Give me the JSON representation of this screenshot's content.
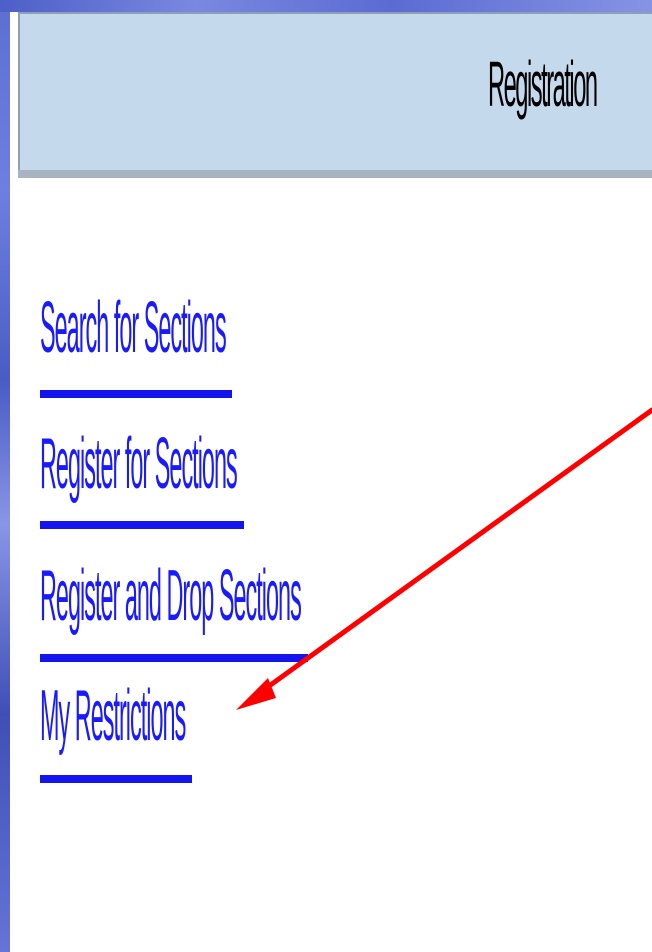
{
  "header": {
    "title": "Registration"
  },
  "links": [
    {
      "label": "Search for Sections"
    },
    {
      "label": "Register for Sections"
    },
    {
      "label": "Register and Drop Sections"
    },
    {
      "label": "My Restrictions"
    }
  ],
  "colors": {
    "header_background": "#c5d9ec",
    "link_color": "#1a1aff",
    "arrow_color": "#ff0000"
  }
}
